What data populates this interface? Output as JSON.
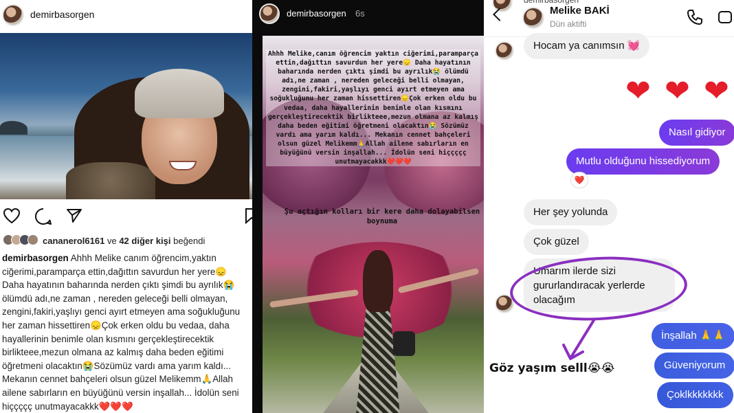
{
  "post": {
    "username": "demirbasorgen",
    "likes": {
      "first_liker": "cananerol6161",
      "connector": "ve",
      "others": "42 diğer kişi",
      "verb": "beğendi"
    },
    "caption_user": "demirbasorgen",
    "caption_text": "Ahhh Melike canım öğrencim,yaktın ciğerimi,paramparça ettin,dağıttın savurdun her yere😞 Daha hayatının baharında nerden çıktı şimdi bu ayrılık😭 ölümdü adı,ne zaman , nereden geleceği belli olmayan, zengini,fakiri,yaşlıyı genci ayırt etmeyen ama soğukluğunu her zaman hissettiren😞Çok erken oldu bu vedaa, daha hayallerinin benimle olan kısmını gerçekleştirecektik birlikteee,mezun olmana az kalmış daha beden eğitimi öğretmeni olacaktın😭Sözümüz vardı ama yarım kaldı... Mekanın cennet bahçeleri olsun güzel Melikemm🙏Allah ailene sabırların en büyüğünü versin inşallah... İdolün seni hiççççç unutmayacakkk❤️❤️❤️"
  },
  "story": {
    "username": "demirbasorgen",
    "time": "6s",
    "text_main": "Ahhh Melike,canım öğrencim yaktın ciğerimi,paramparça ettin,dağıttın savurdun her yere😞 Daha hayatının baharında nerden çıktı şimdi bu ayrılık😭 ölümdü adı,ne zaman , nereden geleceği belli olmayan, zengini,fakiri,yaşlıyı genci ayırt etmeyen ama soğukluğunu her zaman hissettiren😞Çok erken oldu bu vedaa, daha hayallerinin benimle olan kısmını gerçekleştirecektik birlikteee,mezun olmana az kalmış daha beden eğitimi öğretmeni olacaktın😭 Sözümüz vardı ama yarım kaldı... Mekanın cennet bahçeleri olsun güzel Melikemm🙏Allah ailene sabırların en büyüğünü versin inşallah... İdolün seni hiççççç unutmayacakkk❤️❤️❤️",
    "text_secondary": "Şu açtığın kolları bir kere daha dolayabilsen boynuma"
  },
  "dm": {
    "top_cut_name": "demirbasorgen",
    "contact_name": "Melike BAKİ",
    "status": "Dün aktifti",
    "messages": {
      "m1": "Hocam ya canımsın 💓",
      "hearts": "❤️❤️❤️",
      "m2": "Nasıl gidiyor",
      "m3": "Mutlu olduğunu hissediyorum",
      "reaction": "❤️",
      "m4": "Her şey yolunda",
      "m5": "Çok güzel",
      "m6a": "Umarım ilerde sizi",
      "m6b": "gururlandıracak yerlerde",
      "m6c": "olacağım",
      "m7": "İnşallah 🙏🙏",
      "m8": "Güveniyorum",
      "m9": "Çoklkkkkkkk"
    },
    "annotation": "Göz yaşım selll😭😭",
    "accent_color": "#7b3ce6",
    "annotation_color": "#8a2fc0"
  }
}
